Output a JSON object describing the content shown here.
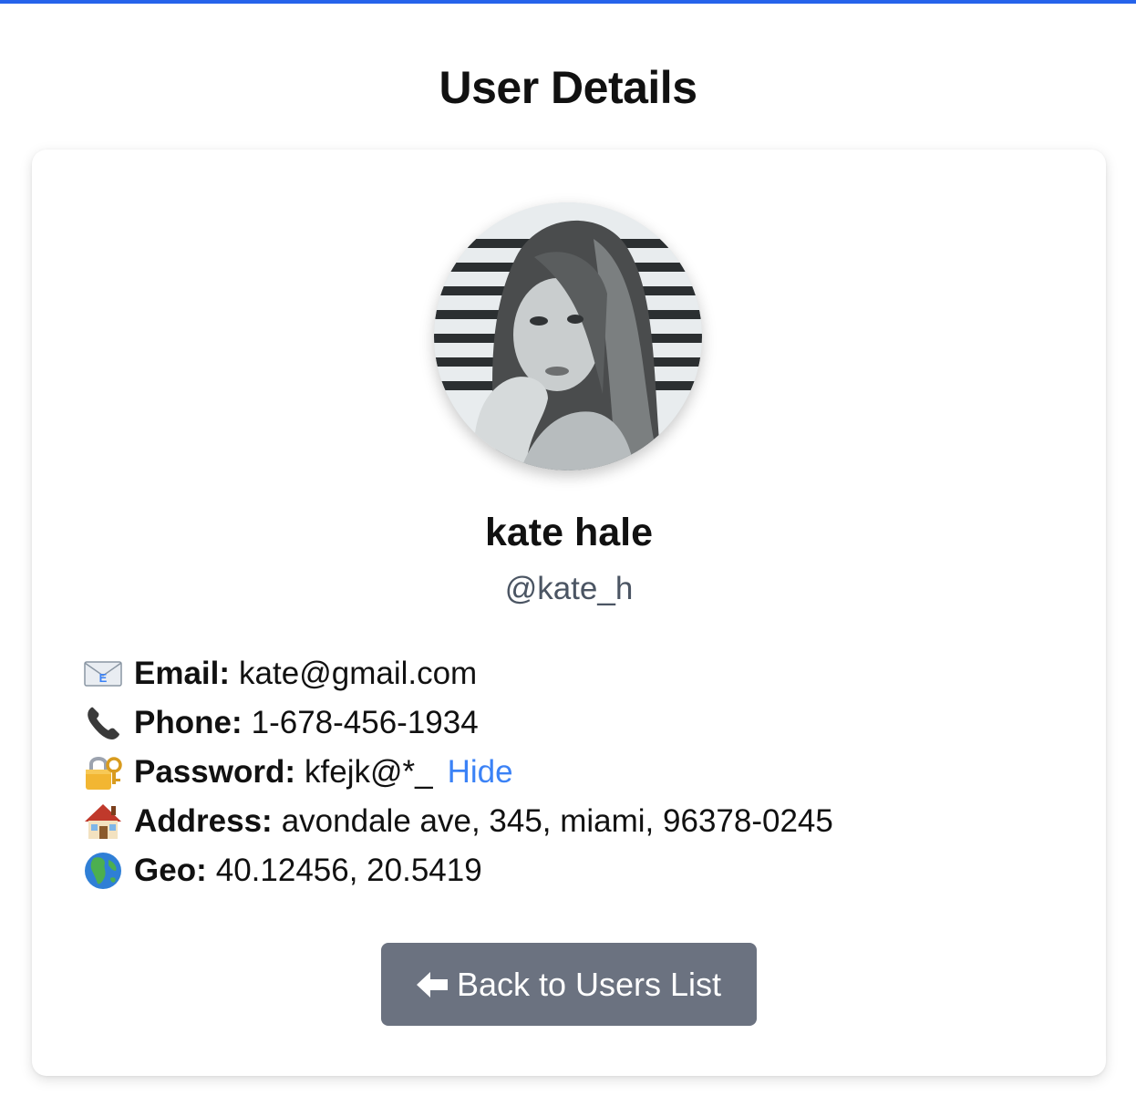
{
  "page": {
    "title": "User Details",
    "accent_color": "#2563eb"
  },
  "user": {
    "name": "kate hale",
    "username": "@kate_h",
    "avatar_icon": "user-photo"
  },
  "details": {
    "email": {
      "icon": "envelope-icon",
      "label": "Email:",
      "value": "kate@gmail.com"
    },
    "phone": {
      "icon": "phone-icon",
      "label": "Phone:",
      "value": "1-678-456-1934"
    },
    "password": {
      "icon": "lock-key-icon",
      "label": "Password:",
      "value": "kfejk@*_",
      "toggle_label": "Hide"
    },
    "address": {
      "icon": "house-icon",
      "label": "Address:",
      "value": "avondale ave, 345, miami, 96378-0245"
    },
    "geo": {
      "icon": "globe-icon",
      "label": "Geo:",
      "value": "40.12456, 20.5419"
    }
  },
  "actions": {
    "back_label": "Back to Users List",
    "back_icon": "arrow-left-icon",
    "button_color": "#6b7280"
  }
}
